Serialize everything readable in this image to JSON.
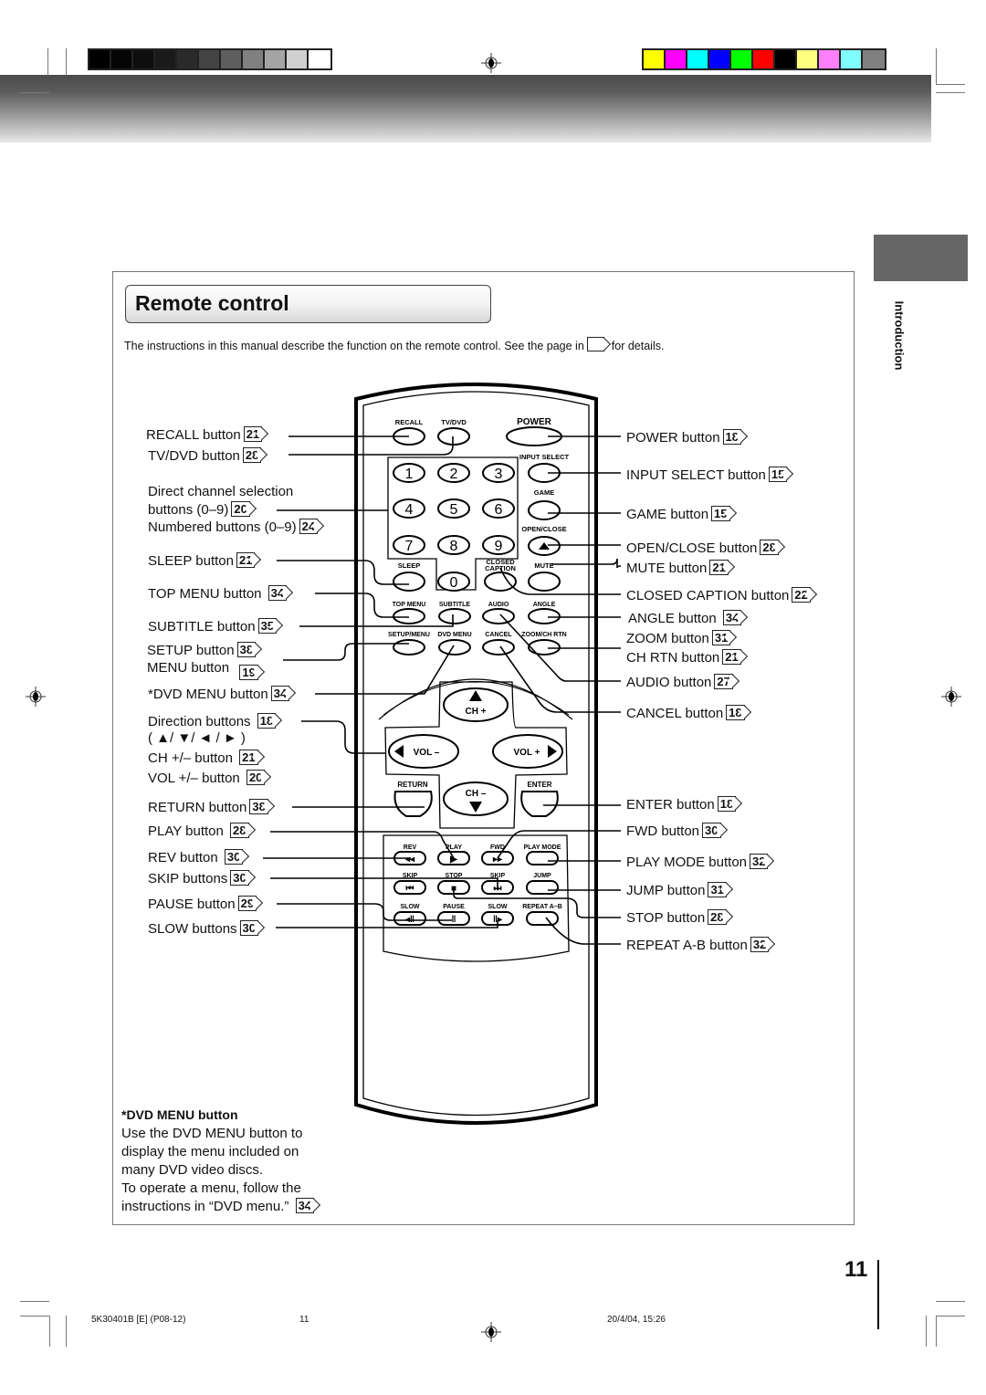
{
  "print_marks": {
    "grayscale_bar": [
      "#000000",
      "#050505",
      "#0e0e0e",
      "#1a1a1a",
      "#2a2a2a",
      "#444444",
      "#5e5e5e",
      "#808080",
      "#a4a4a4",
      "#d0d0d0",
      "#ffffff"
    ],
    "color_bar": [
      "#ffff00",
      "#ff00ff",
      "#00ffff",
      "#0000ff",
      "#00ff00",
      "#ff0000",
      "#000000",
      "#ffff80",
      "#ff80ff",
      "#80ffff",
      "#808080"
    ]
  },
  "side_tab": {
    "label": "Introduction"
  },
  "section": {
    "title": "Remote control",
    "intro_before": "The instructions in this manual describe the function on the remote control. See the page in",
    "intro_after": "for details."
  },
  "remote": {
    "keys": {
      "recall": "RECALL",
      "tvdvd": "TV/DVD",
      "power": "POWER",
      "input_select": "INPUT SELECT",
      "game": "GAME",
      "open_close": "OPEN/CLOSE",
      "sleep": "SLEEP",
      "closed_caption_1": "CLOSED",
      "closed_caption_2": "CAPTION",
      "mute": "MUTE",
      "top_menu": "TOP MENU",
      "subtitle": "SUBTITLE",
      "audio": "AUDIO",
      "angle": "ANGLE",
      "setup_menu": "SETUP/MENU",
      "dvd_menu": "DVD MENU",
      "cancel": "CANCEL",
      "zoom_ch_rtn": "ZOOM/CH RTN",
      "ch_plus": "CH +",
      "ch_minus": "CH –",
      "vol_minus": "VOL –",
      "vol_plus": "VOL +",
      "return": "RETURN",
      "enter": "ENTER",
      "rev": "REV",
      "play": "PLAY",
      "fwd": "FWD",
      "play_mode": "PLAY MODE",
      "skip_back": "SKIP",
      "stop": "STOP",
      "skip_fwd": "SKIP",
      "jump": "JUMP",
      "slow_back": "SLOW",
      "pause": "PAUSE",
      "slow_fwd": "SLOW",
      "repeat_ab": "REPEAT A–B"
    },
    "digits": [
      "1",
      "2",
      "3",
      "4",
      "5",
      "6",
      "7",
      "8",
      "9",
      "0"
    ]
  },
  "callouts_left": [
    {
      "text": "RECALL button",
      "page": "21"
    },
    {
      "text": "TV/DVD button",
      "page": "28"
    },
    {
      "text": "Direct channel selection",
      "page": ""
    },
    {
      "text": "buttons (0–9)",
      "page": "20"
    },
    {
      "text": "Numbered buttons (0–9)",
      "page": "24"
    },
    {
      "text": "SLEEP button",
      "page": "21"
    },
    {
      "text": "TOP MENU button",
      "page": "34"
    },
    {
      "text": "SUBTITLE button",
      "page": "35"
    },
    {
      "text": "SETUP button",
      "page": "38"
    },
    {
      "text": "MENU button",
      "page": "19"
    },
    {
      "text": "*DVD MENU button",
      "page": "34"
    },
    {
      "text": "Direction buttons",
      "page": "18"
    },
    {
      "text": "( ▲/ ▼/ ◄ / ► )",
      "page": ""
    },
    {
      "text": "CH +/– button",
      "page": "21"
    },
    {
      "text": "VOL +/– button",
      "page": "20"
    },
    {
      "text": "RETURN button",
      "page": "38"
    },
    {
      "text": "PLAY button",
      "page": "28"
    },
    {
      "text": "REV button",
      "page": "30"
    },
    {
      "text": "SKIP buttons",
      "page": "30"
    },
    {
      "text": "PAUSE button",
      "page": "29"
    },
    {
      "text": "SLOW buttons",
      "page": "30"
    }
  ],
  "callouts_right": [
    {
      "text": "POWER button",
      "page": "18"
    },
    {
      "text": "INPUT SELECT button",
      "page": "15"
    },
    {
      "text": "GAME button",
      "page": "15"
    },
    {
      "text": "OPEN/CLOSE button",
      "page": "28"
    },
    {
      "text": "MUTE button",
      "page": "21"
    },
    {
      "text": "CLOSED CAPTION button",
      "page": "22"
    },
    {
      "text": "ANGLE button",
      "page": "34"
    },
    {
      "text": "ZOOM button",
      "page": "31"
    },
    {
      "text": "CH RTN button",
      "page": "21"
    },
    {
      "text": "AUDIO button",
      "page": "27"
    },
    {
      "text": "CANCEL button",
      "page": "18"
    },
    {
      "text": "ENTER button",
      "page": "18"
    },
    {
      "text": "FWD button",
      "page": "30"
    },
    {
      "text": "PLAY MODE button",
      "page": "32"
    },
    {
      "text": "JUMP button",
      "page": "31"
    },
    {
      "text": "STOP button",
      "page": "28"
    },
    {
      "text": "REPEAT A-B button",
      "page": "32"
    }
  ],
  "note": {
    "heading": "*DVD MENU button",
    "lines": [
      "Use the DVD MENU button to",
      "display the menu included on",
      "many DVD video discs.",
      "To operate a menu, follow the",
      "instructions in “DVD menu.”"
    ],
    "page": "34"
  },
  "page_number": "11",
  "footer": {
    "code": "5K30401B [E] (P08-12)",
    "page": "11",
    "timestamp": "20/4/04, 15:26"
  }
}
